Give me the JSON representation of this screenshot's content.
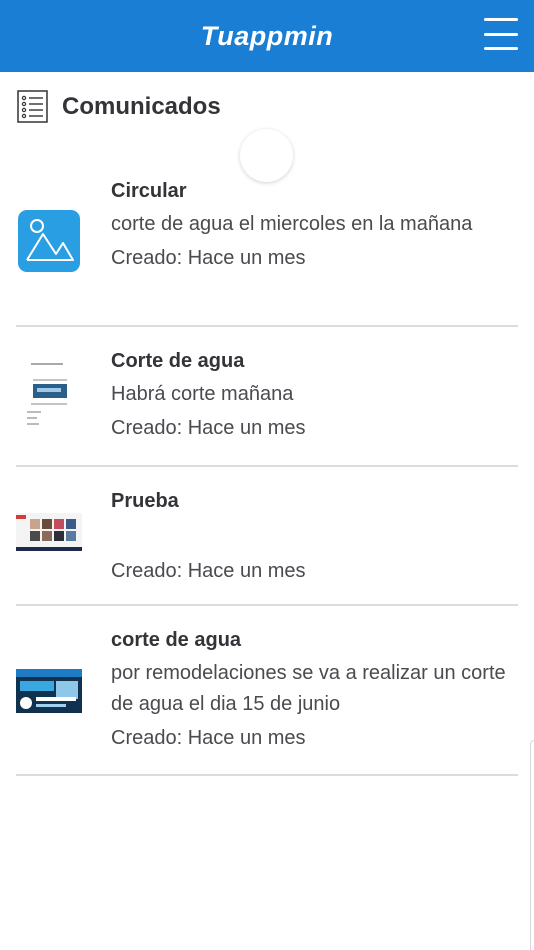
{
  "header": {
    "title": "Tuappmin",
    "menu_icon": "hamburger-menu-icon",
    "background": "#1a7fd4"
  },
  "section": {
    "title": "Comunicados",
    "icon": "list-icon"
  },
  "items": [
    {
      "title": "Circular",
      "description": "corte de agua el miercoles en la mañana",
      "created": "Creado: Hace un mes",
      "thumbnail": "placeholder-image-icon"
    },
    {
      "title": "Corte de agua",
      "description": "Habrá corte mañana",
      "created": "Creado: Hace un mes",
      "thumbnail": "document-thumbnail"
    },
    {
      "title": "Prueba",
      "description": "",
      "created": "Creado: Hace un mes",
      "thumbnail": "screenshot-thumbnail"
    },
    {
      "title": "corte de agua",
      "description": "por remodelaciones se va a realizar un corte de agua el dia 15 de junio",
      "created": "Creado: Hace un mes",
      "thumbnail": "banner-thumbnail"
    }
  ]
}
